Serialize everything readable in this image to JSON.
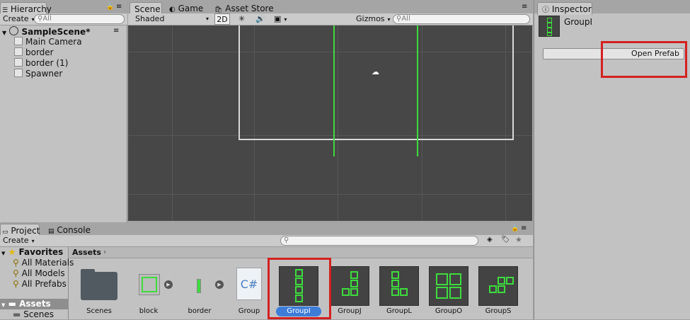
{
  "hierarchy": {
    "tab_label": "Hierarchy",
    "create_label": "Create",
    "search_placeholder": "All",
    "scene_name": "SampleScene*",
    "items": [
      "Main Camera",
      "border",
      "border (1)",
      "Spawner"
    ]
  },
  "scene_tabs": [
    "Scene",
    "Game",
    "Asset Store"
  ],
  "scene_toolbar": {
    "shading": "Shaded",
    "mode_2d": "2D",
    "gizmos": "Gizmos",
    "search_placeholder": "All"
  },
  "inspector": {
    "tab_label": "Inspector",
    "object_name": "GroupI",
    "open_prefab_label": "Open Prefab"
  },
  "project": {
    "tabs": [
      "Project",
      "Console"
    ],
    "create_label": "Create",
    "favorites_label": "Favorites",
    "favorites": [
      "All Materials",
      "All Models",
      "All Prefabs"
    ],
    "assets_folder": "Assets",
    "subfolders": [
      "Scenes"
    ],
    "breadcrumb": "Assets",
    "assets": [
      "Scenes",
      "block",
      "border",
      "Group",
      "GroupI",
      "GroupJ",
      "GroupL",
      "GroupO",
      "GroupS"
    ],
    "selected_asset": "GroupI"
  },
  "colors": {
    "accent_green": "#3ddc3d",
    "highlight_red": "#d42020",
    "selection_blue": "#3d7dd8",
    "scene_bg": "#474747"
  }
}
